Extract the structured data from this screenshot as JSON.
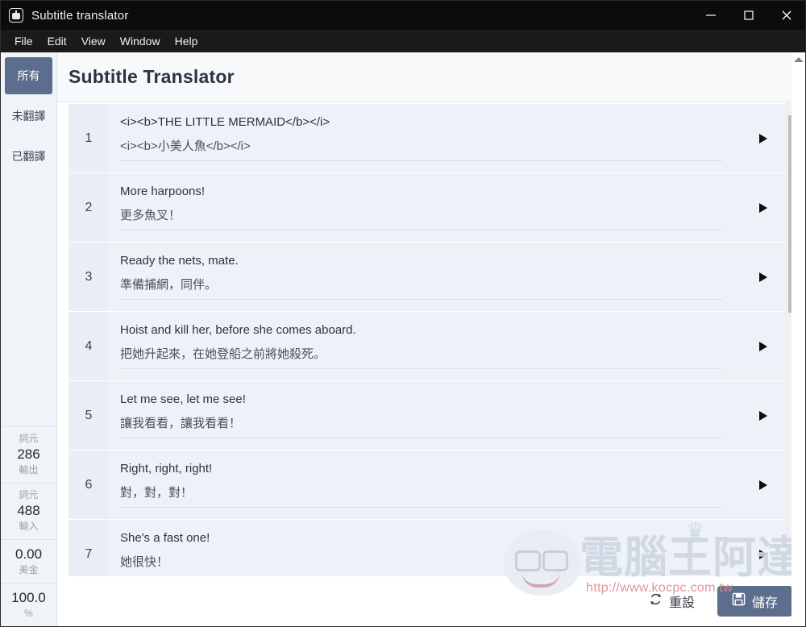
{
  "window": {
    "title": "Subtitle translator",
    "app_icon": "robot-icon",
    "controls": {
      "minimize": "minimize-icon",
      "maximize": "maximize-icon",
      "close": "close-icon"
    }
  },
  "menubar": {
    "items": [
      "File",
      "Edit",
      "View",
      "Window",
      "Help"
    ]
  },
  "sidebar": {
    "filters": [
      {
        "label": "所有",
        "selected": true
      },
      {
        "label": "未翻譯",
        "selected": false
      },
      {
        "label": "已翻譯",
        "selected": false
      }
    ],
    "stats": [
      {
        "top_label": "詞元",
        "value": "286",
        "bottom_label": "輸出"
      },
      {
        "top_label": "詞元",
        "value": "488",
        "bottom_label": "輸入"
      },
      {
        "top_label": "",
        "value": "0.00",
        "bottom_label": "美金"
      },
      {
        "top_label": "",
        "value": "100.0",
        "bottom_label": "%"
      }
    ]
  },
  "header": {
    "title": "Subtitle Translator"
  },
  "list": {
    "rows": [
      {
        "index": "1",
        "source": "<i><b>THE LITTLE MERMAID</b></i>",
        "target": "<i><b>小美人魚</b></i>",
        "play": "play-icon"
      },
      {
        "index": "2",
        "source": "More harpoons!",
        "target": "更多魚叉！",
        "play": "play-icon"
      },
      {
        "index": "3",
        "source": "Ready the nets, mate.",
        "target": "準備捕網，同伴。",
        "play": "play-icon"
      },
      {
        "index": "4",
        "source": "Hoist and kill her, before she comes aboard.",
        "target": "把她升起來，在她登船之前將她殺死。",
        "play": "play-icon"
      },
      {
        "index": "5",
        "source": "Let me see, let me see!",
        "target": "讓我看看，讓我看看！",
        "play": "play-icon"
      },
      {
        "index": "6",
        "source": "Right, right, right!",
        "target": "對，對，對！",
        "play": "play-icon"
      },
      {
        "index": "7",
        "source": "She's a fast one!",
        "target": "她很快！",
        "play": "play-icon"
      }
    ]
  },
  "footer": {
    "reset_label": "重設",
    "reset_icon": "refresh-icon",
    "save_label": "儲存",
    "save_icon": "floppy-disk-icon"
  },
  "watermark": {
    "text": "電腦王阿達",
    "url": "http://www.kocpc.com.tw"
  },
  "colors": {
    "titlebar": "#0c0c0c",
    "menubar": "#1a1a1a",
    "accent": "#5d6d8e",
    "sidebar_bg": "#f0f3f7",
    "row_bg": "#eef2f8",
    "header_bg": "#f7f9fb"
  }
}
